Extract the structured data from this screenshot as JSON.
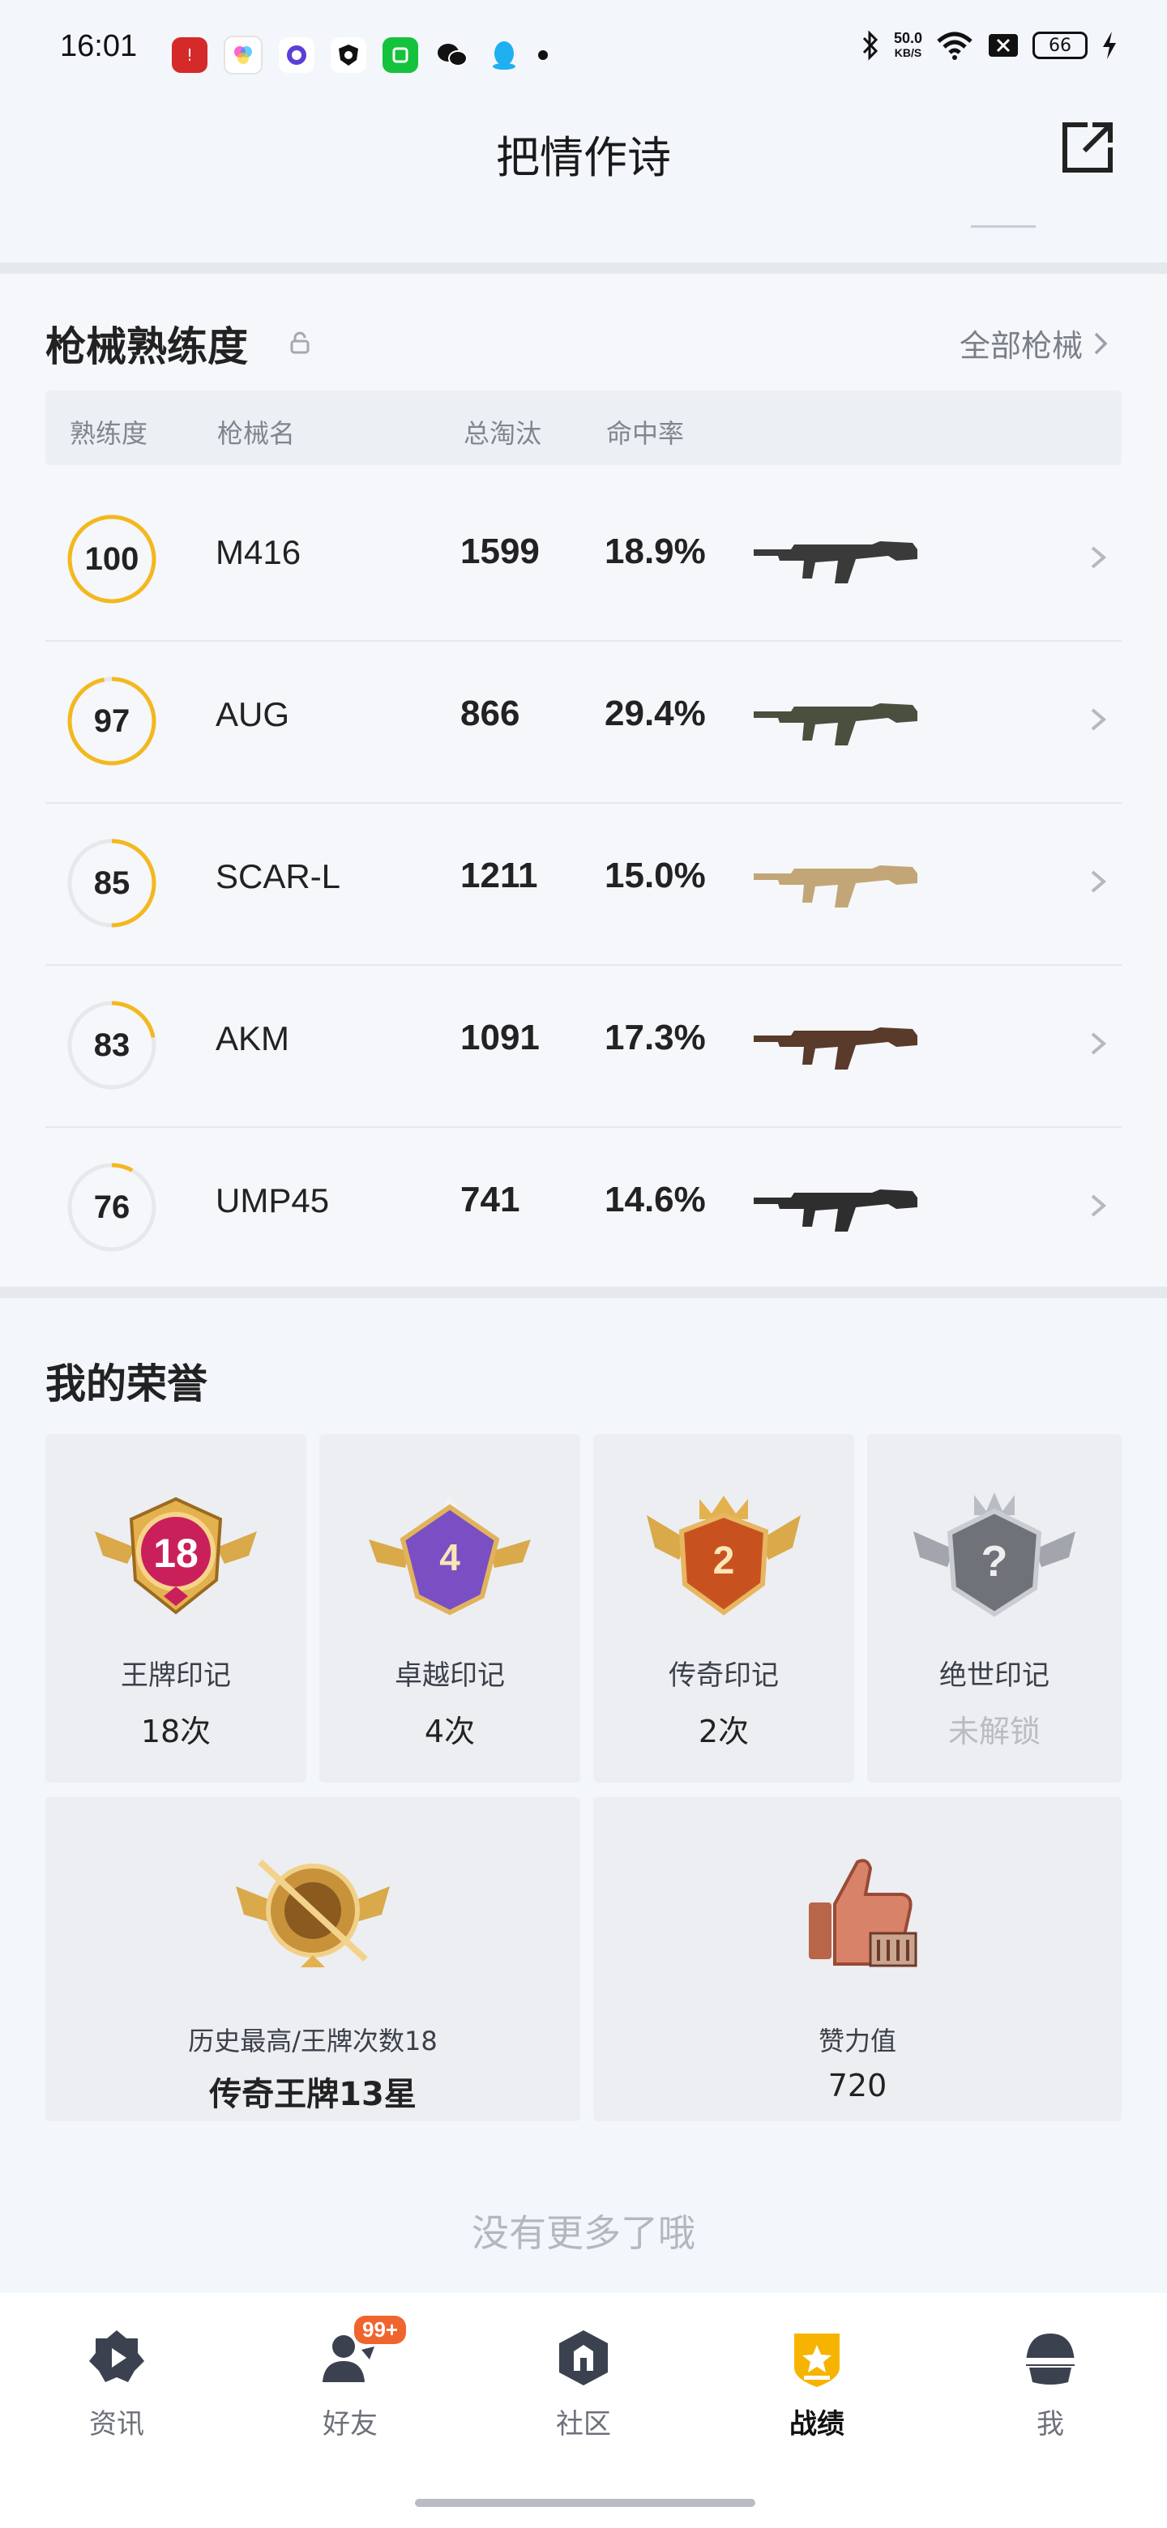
{
  "status_bar": {
    "time": "16:01",
    "net_speed_value": "50.0",
    "net_speed_unit": "KB/S",
    "battery": "66"
  },
  "header": {
    "title": "把情作诗"
  },
  "weapons": {
    "title": "枪械熟练度",
    "all_link": "全部枪械",
    "columns": [
      "熟练度",
      "枪械名",
      "总淘汰",
      "命中率"
    ],
    "rows": [
      {
        "proficiency": "100",
        "name": "M416",
        "kills": "1599",
        "hit_rate": "18.9%",
        "progress": 1.0
      },
      {
        "proficiency": "97",
        "name": "AUG",
        "kills": "866",
        "hit_rate": "29.4%",
        "progress": 0.97
      },
      {
        "proficiency": "85",
        "name": "SCAR-L",
        "kills": "1211",
        "hit_rate": "15.0%",
        "progress": 0.5
      },
      {
        "proficiency": "83",
        "name": "AKM",
        "kills": "1091",
        "hit_rate": "17.3%",
        "progress": 0.22
      },
      {
        "proficiency": "76",
        "name": "UMP45",
        "kills": "741",
        "hit_rate": "14.6%",
        "progress": 0.08
      }
    ]
  },
  "honors": {
    "title": "我的荣誉",
    "marks": [
      {
        "label": "王牌印记",
        "count": "18次",
        "badge_number": "18"
      },
      {
        "label": "卓越印记",
        "count": "4次",
        "badge_number": "4"
      },
      {
        "label": "传奇印记",
        "count": "2次",
        "badge_number": "2"
      },
      {
        "label": "绝世印记",
        "count": "未解锁",
        "badge_number": "?"
      }
    ],
    "best": {
      "label": "历史最高/王牌次数18",
      "value": "传奇王牌13星"
    },
    "likes": {
      "label": "赞力值",
      "value": "720"
    }
  },
  "footer_text": "没有更多了哦",
  "tabbar": {
    "friends_badge": "99+",
    "tabs": [
      {
        "label": "资讯",
        "icon": "news-icon"
      },
      {
        "label": "好友",
        "icon": "friends-icon"
      },
      {
        "label": "社区",
        "icon": "community-icon"
      },
      {
        "label": "战绩",
        "icon": "record-icon",
        "active": true
      },
      {
        "label": "我",
        "icon": "profile-helmet-icon"
      }
    ]
  }
}
